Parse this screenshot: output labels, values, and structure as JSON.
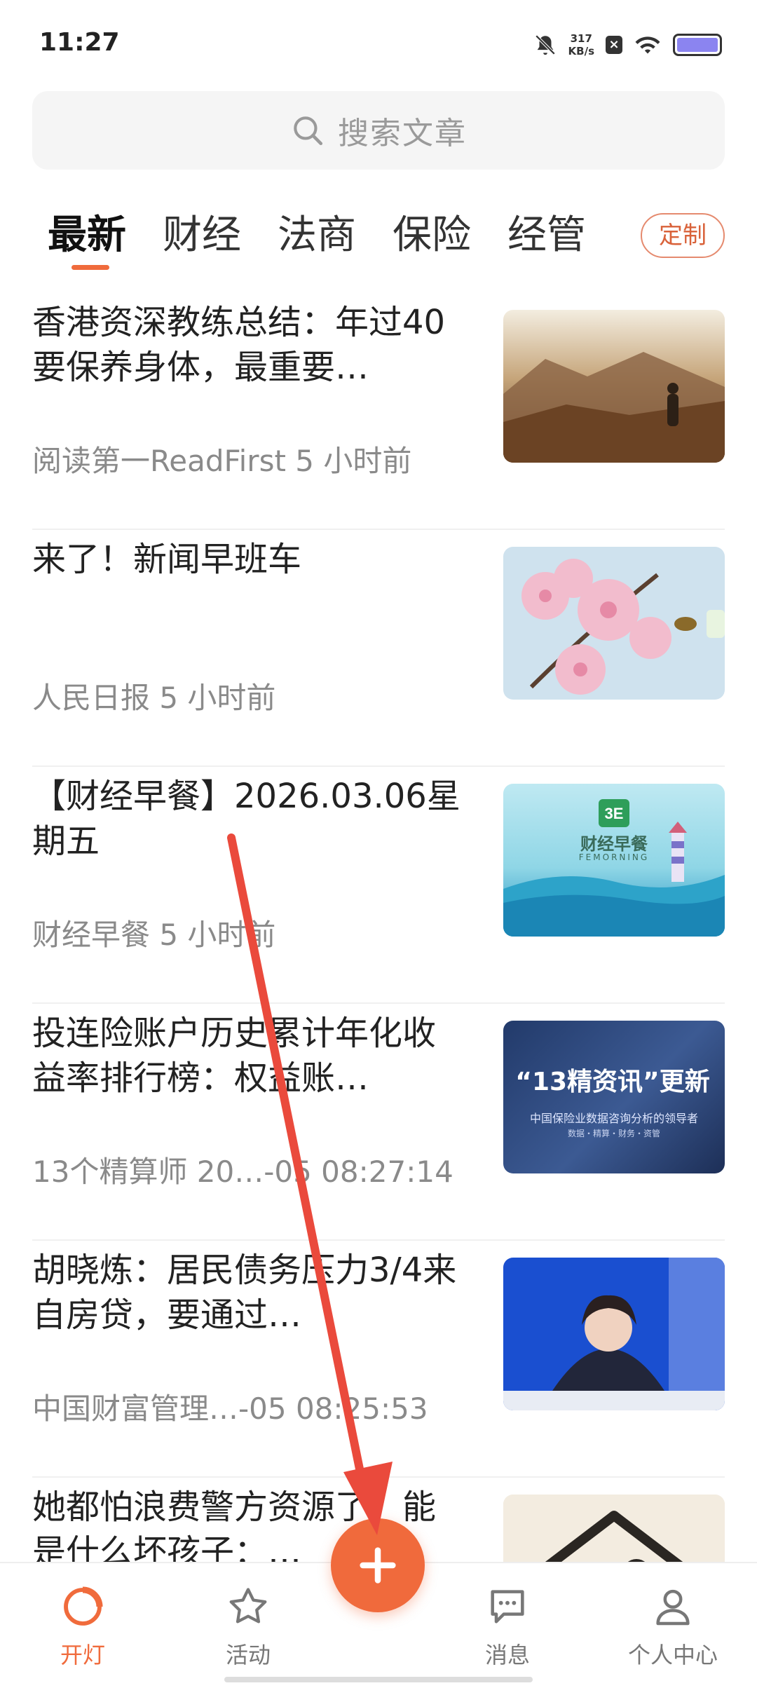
{
  "status_bar": {
    "time": "11:27",
    "speed_value": "317",
    "speed_unit": "KB/s",
    "battery_color": "#8b84f0"
  },
  "search": {
    "placeholder": "搜索文章",
    "icon": "search-icon"
  },
  "tabs": [
    {
      "label": "最新",
      "active": true
    },
    {
      "label": "财经",
      "active": false
    },
    {
      "label": "法商",
      "active": false
    },
    {
      "label": "保险",
      "active": false
    },
    {
      "label": "经管",
      "active": false
    }
  ],
  "customize_label": "定制",
  "accent_color": "#f06b3c",
  "feed": [
    {
      "title": "香港资深教练总结：年过40要保养身体，最重要…",
      "meta": "阅读第一ReadFirst 5 小时前",
      "thumb": "mountain-hiker-photo"
    },
    {
      "title": "来了！新闻早班车",
      "meta": "人民日报 5 小时前",
      "thumb": "blossom-bee-photo"
    },
    {
      "title": "【财经早餐】2026.03.06星期五",
      "meta": "财经早餐 5 小时前",
      "thumb": "fe-morning-banner",
      "thumb_brand": "财经早餐",
      "thumb_sub": "FEMORNING"
    },
    {
      "title": "投连险账户历史累计年化收益率排行榜：权益账…",
      "meta": "13个精算师 20…-05 08:27:14",
      "thumb": "actuary-banner",
      "thumb_text": "“13精资讯”更新",
      "thumb_sub": "中国保险业数据咨询分析的领导者",
      "thumb_sub2": "数据・精算・财务・资管"
    },
    {
      "title": "胡晓炼：居民债务压力3/4来自房贷，要通过…",
      "meta": "中国财富管理…-05 08:25:53",
      "thumb": "speaker-photo"
    },
    {
      "title": "她都怕浪费警方资源了，能是什么坏孩子：…",
      "meta": "",
      "thumb": "house-illustration"
    }
  ],
  "bottom_nav": [
    {
      "label": "开灯",
      "icon": "lamp-icon",
      "active": true
    },
    {
      "label": "活动",
      "icon": "star-icon",
      "active": false
    },
    {
      "label": "消息",
      "icon": "message-icon",
      "active": false
    },
    {
      "label": "个人中心",
      "icon": "person-icon",
      "active": false
    }
  ],
  "fab_icon": "plus-icon"
}
